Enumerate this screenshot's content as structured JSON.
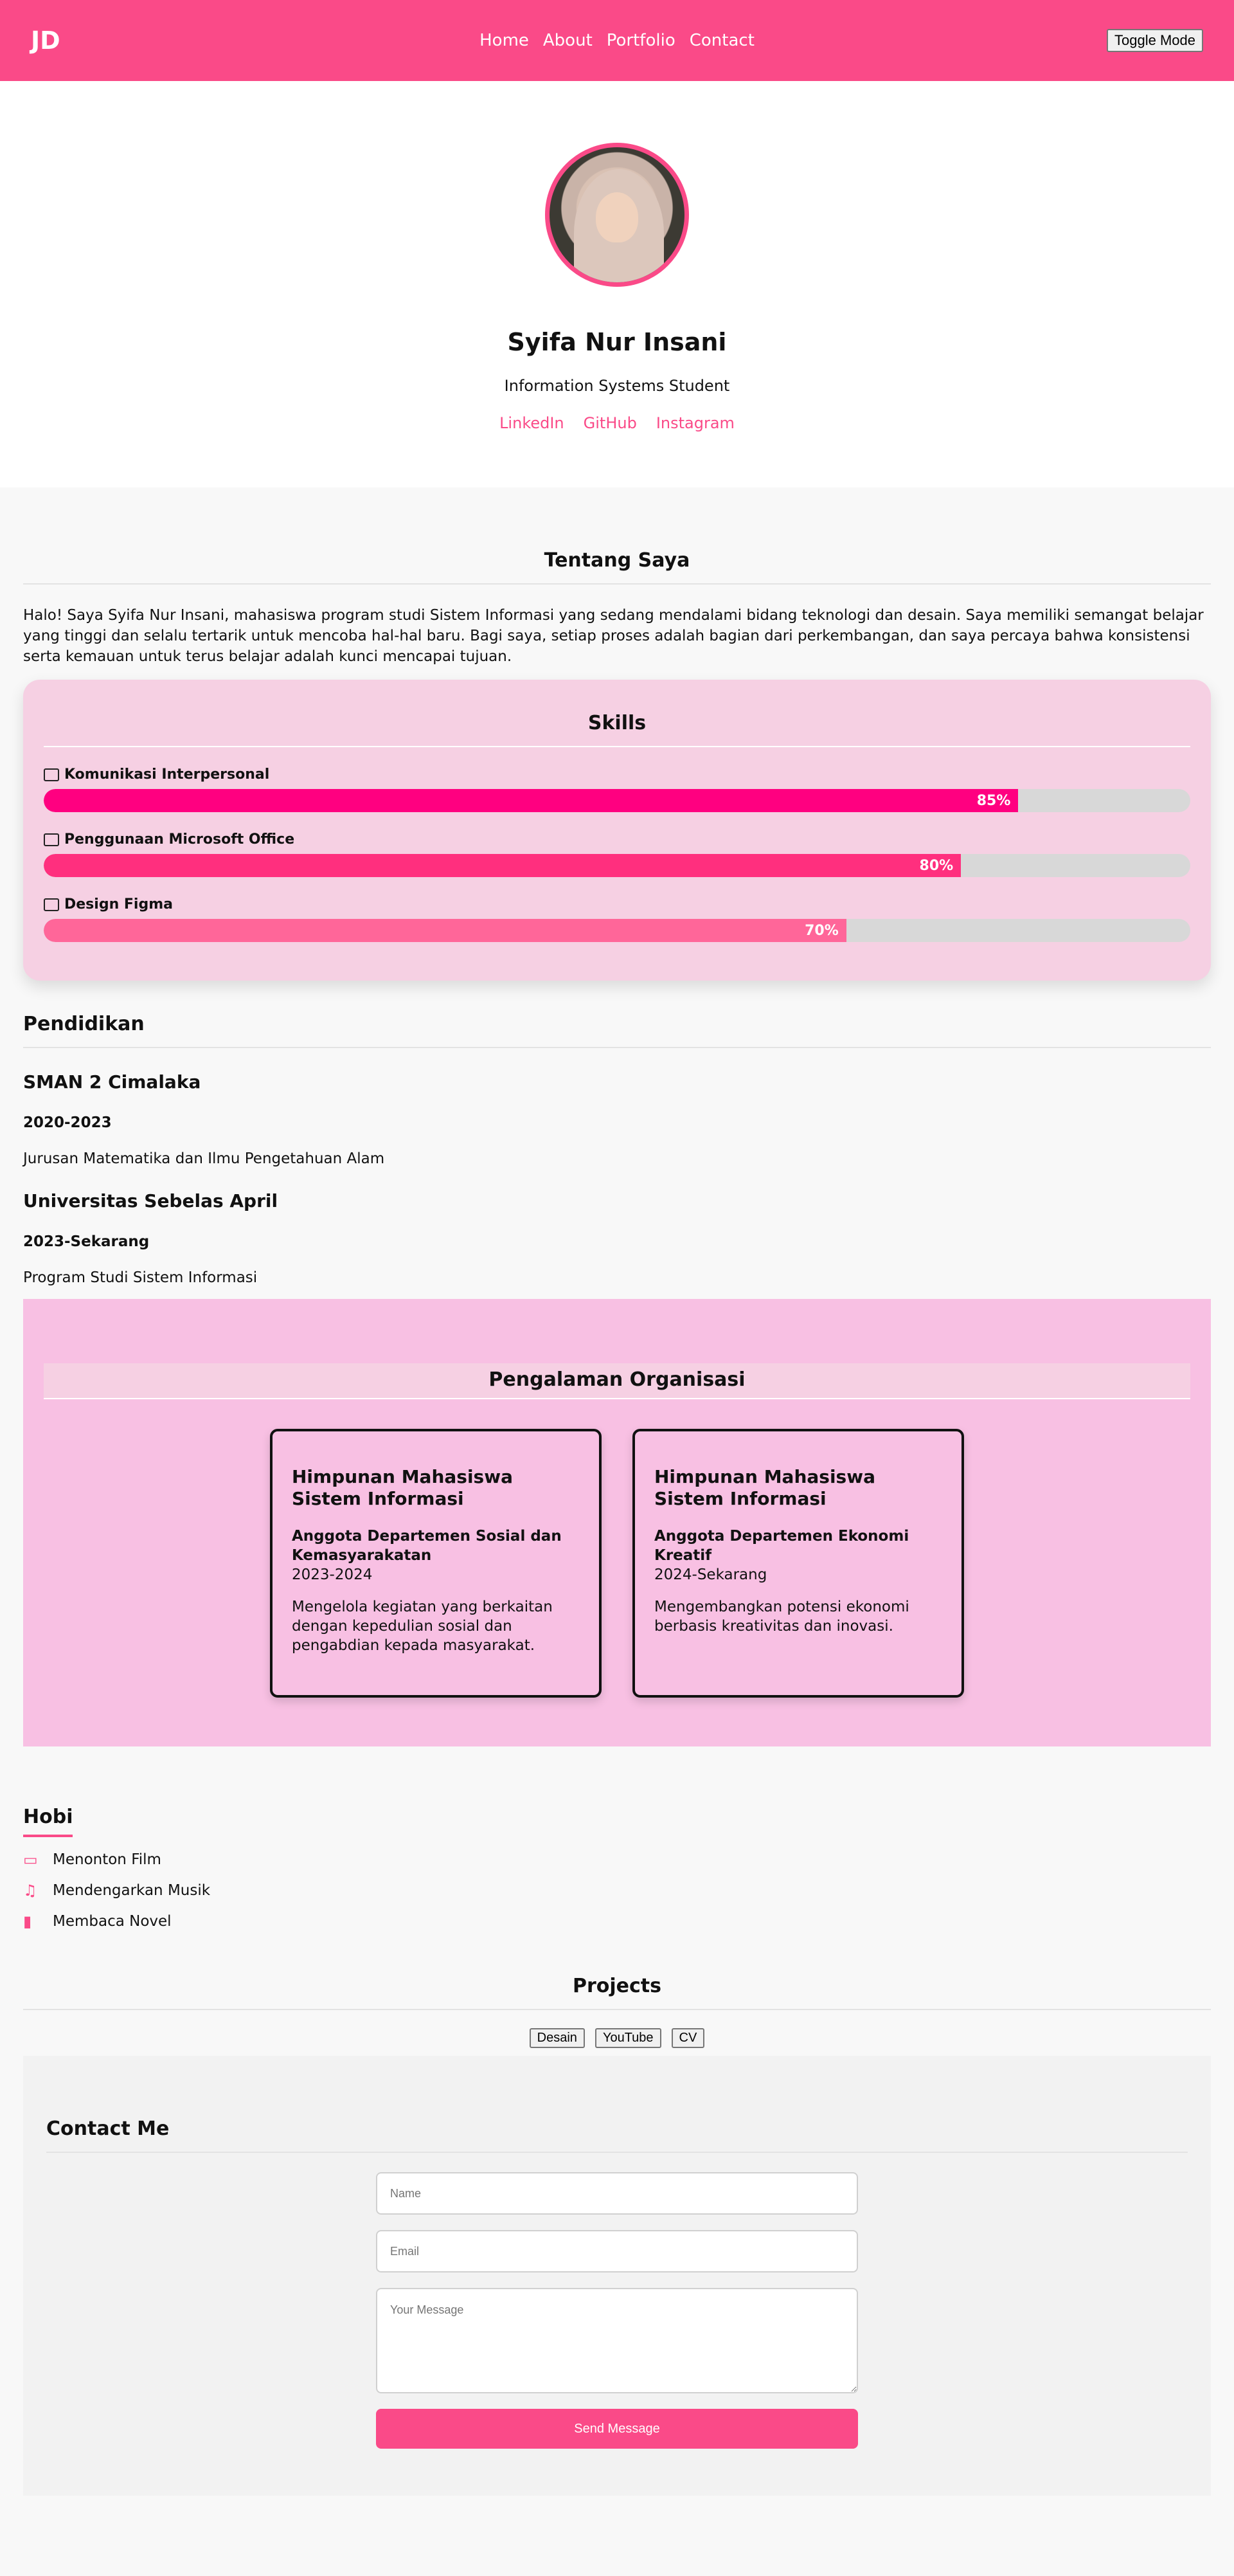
{
  "header": {
    "logo": "JD",
    "nav": [
      "Home",
      "About",
      "Portfolio",
      "Contact"
    ],
    "toggle_label": "Toggle Mode"
  },
  "hero": {
    "name": "Syifa Nur Insani",
    "role": "Information Systems Student",
    "links": [
      "LinkedIn",
      "GitHub",
      "Instagram"
    ]
  },
  "about": {
    "title": "Tentang Saya",
    "text": "Halo! Saya Syifa Nur Insani, mahasiswa program studi Sistem Informasi yang sedang mendalami bidang teknologi dan desain. Saya memiliki semangat belajar yang tinggi dan selalu tertarik untuk mencoba hal-hal baru. Bagi saya, setiap proses adalah bagian dari perkembangan, dan saya percaya bahwa konsistensi serta kemauan untuk terus belajar adalah kunci mencapai tujuan."
  },
  "skills": {
    "title": "Skills",
    "items": [
      {
        "label": "Komunikasi Interpersonal",
        "percent": 85,
        "percent_label": "85%",
        "color": "#ff0080",
        "icon": "computer-icon"
      },
      {
        "label": "Penggunaan Microsoft Office",
        "percent": 80,
        "percent_label": "80%",
        "color": "#ff2f7e",
        "icon": "laptop-icon"
      },
      {
        "label": "Design Figma",
        "percent": 70,
        "percent_label": "70%",
        "color": "#ff6699",
        "icon": "figma-icon"
      }
    ]
  },
  "education": {
    "title": "Pendidikan",
    "entries": [
      {
        "school": "SMAN 2 Cimalaka",
        "years": "2020-2023",
        "desc": "Jurusan Matematika dan Ilmu Pengetahuan Alam"
      },
      {
        "school": "Universitas Sebelas April",
        "years": "2023-Sekarang",
        "desc": "Program Studi Sistem Informasi"
      }
    ]
  },
  "organization": {
    "title": "Pengalaman Organisasi",
    "cards": [
      {
        "org": "Himpunan Mahasiswa Sistem Informasi",
        "role": "Anggota Departemen Sosial dan Kemasyarakatan",
        "period": "2023-2024",
        "desc": "Mengelola kegiatan yang berkaitan dengan kepedulian sosial dan pengabdian kepada masyarakat."
      },
      {
        "org": "Himpunan Mahasiswa Sistem Informasi",
        "role": "Anggota Departemen Ekonomi Kreatif",
        "period": "2024-Sekarang",
        "desc": "Mengembangkan potensi ekonomi berbasis kreativitas dan inovasi."
      }
    ]
  },
  "hobby": {
    "title": "Hobi",
    "items": [
      {
        "label": "Menonton Film",
        "icon": "laptop-icon"
      },
      {
        "label": "Mendengarkan Musik",
        "icon": "music-icon"
      },
      {
        "label": "Membaca Novel",
        "icon": "book-icon"
      }
    ]
  },
  "projects": {
    "title": "Projects",
    "buttons": [
      "Desain",
      "YouTube",
      "CV"
    ]
  },
  "contact": {
    "title": "Contact Me",
    "name_placeholder": "Name",
    "email_placeholder": "Email",
    "message_placeholder": "Your Message",
    "submit_label": "Send Message"
  },
  "colors": {
    "accent": "#fa4a88",
    "skills_bg": "#f6d0e3",
    "org_bg": "#f8c0e3"
  }
}
